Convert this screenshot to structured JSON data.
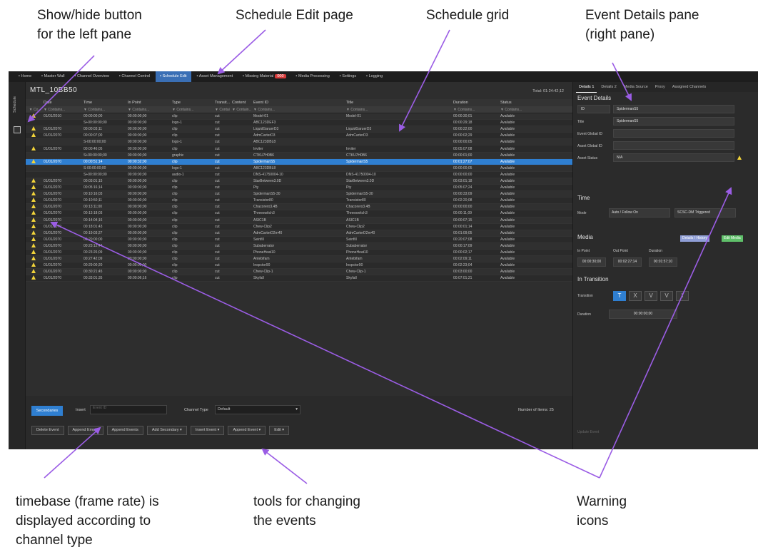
{
  "callouts": {
    "show_hide": [
      "Show/hide button",
      "for the left pane"
    ],
    "schedule_edit": "Schedule Edit page",
    "schedule_grid": "Schedule grid",
    "event_details": [
      "Event Details pane",
      "(right pane)"
    ],
    "timebase": [
      "timebase (frame rate) is",
      "displayed according to",
      "channel type"
    ],
    "tools": [
      "tools for changing",
      "the events"
    ],
    "warning": [
      "Warning",
      "icons"
    ]
  },
  "nav": [
    {
      "icon": "home-icon",
      "label": "Home"
    },
    {
      "icon": "grid-icon",
      "label": "Master Wall"
    },
    {
      "icon": "grid-icon",
      "label": "Channel Overview"
    },
    {
      "icon": "grid-icon",
      "label": "Channel Control"
    },
    {
      "icon": "list-icon",
      "label": "Schedule Edit",
      "active": true
    },
    {
      "icon": "folder-icon",
      "label": "Asset Management"
    },
    {
      "icon": "search-icon",
      "label": "Missing Material",
      "badge": "000"
    },
    {
      "icon": "film-icon",
      "label": "Media Processing"
    },
    {
      "icon": "gear-icon",
      "label": "Settings"
    },
    {
      "icon": "log-icon",
      "label": "Logging"
    }
  ],
  "left_tab": {
    "label": "Schedule"
  },
  "page_title": "MTL_10BB50",
  "total": "Total: 01:24:42;12",
  "grid": {
    "columns": [
      "",
      "Date",
      "Time",
      "In Point",
      "Type",
      "Transit...",
      "Content",
      "Event ID",
      "Title",
      "Duration",
      "Status"
    ],
    "filters": [
      "▼ Co",
      "▼ Contains...",
      "▼ Contains...",
      "▼ Contains...",
      "▼ Contains...",
      "▼ Contains",
      "▼ Contain...",
      "▼ Contains...",
      "▼ Contains...",
      "▼ Contains...",
      "▼ Contains..."
    ],
    "rows": [
      [
        "w",
        "01/01/2010",
        "00:00:00;00",
        "00:00:00;00",
        "clip",
        "cut",
        "",
        "Model-01",
        "Model-01",
        "00:00:30;01",
        "Available"
      ],
      [
        "",
        "",
        "S+00:00:00;00",
        "00:00:00;00",
        "logo-1",
        "cut",
        "",
        "ABC123DEF3",
        "",
        "00:00:29;18",
        "Available"
      ],
      [
        "w",
        "01/01/2070",
        "00:00:03;11",
        "00:00:00;00",
        "clip",
        "cut",
        "",
        "LiquidGaruerD3",
        "LiquidGaruerD3",
        "00:00:22;00",
        "Available"
      ],
      [
        "w",
        "01/01/2070",
        "00:00:07;00",
        "00:00:00;00",
        "clip",
        "cut",
        "",
        "AdmCarterD3",
        "AdmCarterD3",
        "00:00:02;29",
        "Available"
      ],
      [
        "",
        "",
        "S-00:00:00;00",
        "00:00:00;00",
        "logo-1",
        "cut",
        "",
        "ABC123DBL8",
        "",
        "00:00:00;05",
        "Available"
      ],
      [
        "w",
        "01/01/2070",
        "00:00:46;05",
        "00:00:00;00",
        "clip",
        "cut",
        "",
        "Inviter",
        "Inviter",
        "00:05:07;08",
        "Available"
      ],
      [
        "",
        "",
        "S+00:00:00;00",
        "00:00:00;00",
        "graphic",
        "cut",
        "",
        "CTKU7H0B6",
        "CTKU7H0B6",
        "00:00:01;00",
        "Available"
      ],
      [
        "w",
        "01/01/2070",
        "00:00:51;14",
        "00:00:32;00",
        "clip",
        "cut",
        "",
        "SpidermanS5",
        "SpidermanS5",
        "00:01:27;07",
        "Available"
      ],
      [
        "",
        "",
        "S-00:00:00;00",
        "00:00:00;00",
        "logo-1",
        "cut",
        "",
        "ABC123DBL8",
        "",
        "00:00:00;05",
        "Available"
      ],
      [
        "",
        "",
        "S+00:00:00;00",
        "00:00:00;00",
        "audio-1",
        "cut",
        "",
        "DNS-41750004-10",
        "DNS-41750004-10",
        "00:00:00;00",
        "Available"
      ],
      [
        "w",
        "01/01/2070",
        "00:03:01;15",
        "00:00:00;00",
        "clip",
        "cut",
        "",
        "StarBetween3.0D",
        "StarBetween3.0D",
        "00:03:01;18",
        "Available"
      ],
      [
        "w",
        "01/01/2070",
        "00:05:16;14",
        "00:00:00;00",
        "clip",
        "cut",
        "",
        "Pty",
        "Pty",
        "00:05:07;24",
        "Available"
      ],
      [
        "w",
        "01/01/2070",
        "00:10:16;03",
        "00:00:00;00",
        "clip",
        "cut",
        "",
        "SpidermanS5-30",
        "SpidermanS5-30",
        "00:00:33;09",
        "Available"
      ],
      [
        "w",
        "01/01/2070",
        "00:10:50;11",
        "00:00:00;00",
        "clip",
        "cut",
        "",
        "Transistor80",
        "Transistor80",
        "00:02:20;08",
        "Available"
      ],
      [
        "w",
        "01/01/2070",
        "00:13:11;00",
        "00:00:00;00",
        "clip",
        "cut",
        "",
        "Chacorero3.4B",
        "Chacorero3.4B",
        "00:00:00;00",
        "Available"
      ],
      [
        "w",
        "01/01/2070",
        "00:13:18;03",
        "00:00:00;00",
        "clip",
        "cut",
        "",
        "Threeswitch3",
        "Threeswitch3",
        "00:00:11;09",
        "Available"
      ],
      [
        "w",
        "01/01/2070",
        "00:14:04;16",
        "00:00:00;00",
        "clip",
        "cut",
        "",
        "ASIC1B",
        "ASIC1B",
        "00:00:07;15",
        "Available"
      ],
      [
        "w",
        "01/01/2070",
        "00:18:01;43",
        "00:00:00;00",
        "clip",
        "cut",
        "",
        "Chew-Clip2",
        "Chew-Clip2",
        "00:00:01;14",
        "Available"
      ],
      [
        "w",
        "01/01/2070",
        "00:19:03;27",
        "00:00:00;00",
        "clip",
        "cut",
        "",
        "AdmCarterD2m40",
        "AdmCarterD2m40",
        "00:01:09;05",
        "Available"
      ],
      [
        "w",
        "01/01/2070",
        "00:20:00;00",
        "00:00:00;00",
        "clip",
        "cut",
        "",
        "Seinfill",
        "Seinfill",
        "00:20:07;08",
        "Available"
      ],
      [
        "w",
        "01/01/2070",
        "00:23:12;44",
        "00:00:00;00",
        "clip",
        "cut",
        "",
        "Subaberrator",
        "Subaberrator",
        "00:00:17;09",
        "Available"
      ],
      [
        "w",
        "01/01/2070",
        "00:23:26;09",
        "00:00:00;00",
        "clip",
        "cut",
        "",
        "PhoneHeat10",
        "PhoneHeat10",
        "00:00:02;17",
        "Available"
      ],
      [
        "w",
        "01/01/2070",
        "00:27:42;09",
        "00:00:00;00",
        "clip",
        "cut",
        "",
        "Antebifam",
        "Antebifam",
        "00:02:09;11",
        "Available"
      ],
      [
        "w",
        "01/01/2070",
        "00:29:00;20",
        "00:00:00;00",
        "clip",
        "cut",
        "",
        "Inspctor90",
        "Inspctor90",
        "00:02:23;04",
        "Available"
      ],
      [
        "w",
        "01/01/2070",
        "00:30:21;45",
        "00:00:00;00",
        "clip",
        "cut",
        "",
        "Chew-Clip-1",
        "Chew-Clip-1",
        "00:03:00;00",
        "Available"
      ],
      [
        "w",
        "01/01/2070",
        "00:33:01;35",
        "00:00:06;16",
        "clip",
        "cut",
        "",
        "Skyfall",
        "Skyfall",
        "00:07:01;21",
        "Available"
      ]
    ],
    "selected_index": 7
  },
  "bottom": {
    "timebase": "Secondaries",
    "insert_label": "Insert",
    "insert_placeholder": "Event ID",
    "channel_type_label": "Channel Type",
    "channel_type_value": "Default",
    "num_items": "Number of Items: 25",
    "tools": [
      "Delete Event",
      "Append Empty",
      "Append Events",
      "Add Secondary ▾",
      "Insert Event ▾",
      "Append Event ▾",
      "Edit ▾"
    ]
  },
  "right": {
    "tabs": [
      "Details 1",
      "Details 2",
      "Media Source",
      "Proxy",
      "Assigned Channels"
    ],
    "active_tab": 0,
    "event_details": "Event Details",
    "fields": [
      {
        "label": "ID",
        "value": "SpidermanS5"
      },
      {
        "label": "Title",
        "value": "SpidermanS5"
      },
      {
        "label": "Event Global ID",
        "value": ""
      },
      {
        "label": "Asset Global ID",
        "value": ""
      },
      {
        "label": "Asset Status",
        "value": "N/A"
      }
    ],
    "time": "Time",
    "mode_label": "Mode",
    "mode_value": "Auto / Follow On",
    "trigger_value": "SCSC-DM Triggered",
    "media": "Media",
    "media_badge_blue": "Details / History",
    "media_badge_green": "Edit Media",
    "media_headers": [
      "In Point",
      "Out Point",
      "Duration"
    ],
    "media_values": [
      "00:00:30;00",
      "00:02:27;14",
      "00:01:57;10"
    ],
    "in_transition": "In Transition",
    "transition_label": "Transition",
    "transition_buttons": [
      "T",
      "X",
      "V",
      "V",
      "\\"
    ],
    "duration_label": "Duration",
    "duration_value": "00:00:00;00",
    "update_event": "Update Event"
  }
}
